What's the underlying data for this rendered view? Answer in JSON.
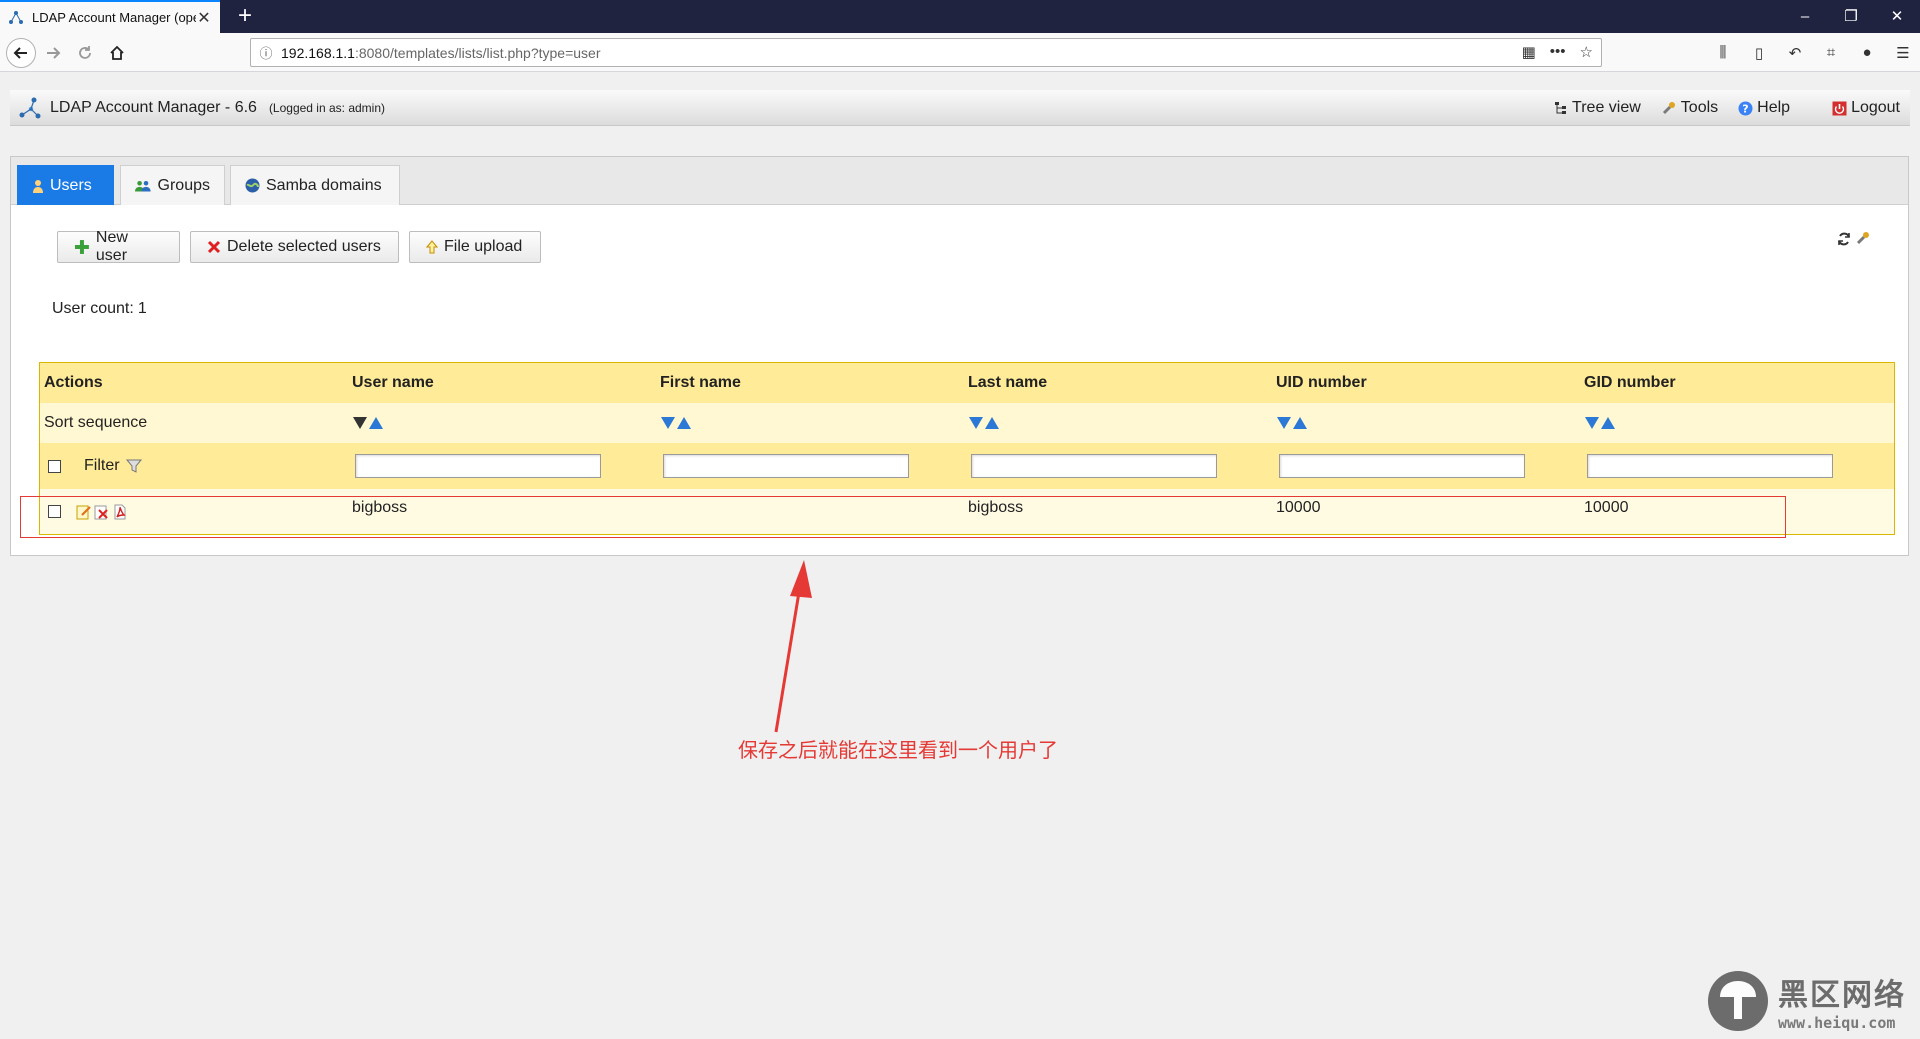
{
  "browser": {
    "tab_title": "LDAP Account Manager (ope",
    "new_tab": "+",
    "url_host": "192.168.1.1",
    "url_path": ":8080/templates/lists/list.php?type=user",
    "controls": {
      "minimize": "–",
      "restore": "❐",
      "close": "✕"
    }
  },
  "app": {
    "title": "LDAP Account Manager - 6.6",
    "logged_in": "(Logged in as: admin)",
    "menu": {
      "tree_view": "Tree view",
      "tools": "Tools",
      "help": "Help",
      "logout": "Logout"
    }
  },
  "tabs": {
    "users": "Users",
    "groups": "Groups",
    "samba_domains": "Samba domains"
  },
  "actions": {
    "new_user": "New user",
    "delete_selected": "Delete selected users",
    "file_upload": "File upload"
  },
  "user_count": {
    "label": "User count:",
    "value": "1"
  },
  "table": {
    "headers": [
      "Actions",
      "User name",
      "First name",
      "Last name",
      "UID number",
      "GID number"
    ],
    "sort_label": "Sort sequence",
    "filter_label": "Filter",
    "rows": [
      {
        "user_name": "bigboss",
        "first_name": "",
        "last_name": "bigboss",
        "uid": "10000",
        "gid": "10000"
      }
    ]
  },
  "annotation": "保存之后就能在这里看到一个用户了",
  "watermark": {
    "main": "黑区网络",
    "sub": "www.heiqu.com"
  },
  "colors": {
    "accent_blue": "#1a7be6",
    "table_header": "#ffeb98",
    "annotation_red": "#e53935"
  }
}
